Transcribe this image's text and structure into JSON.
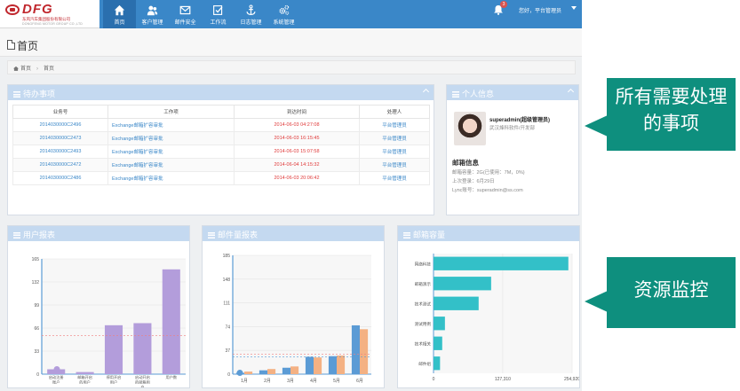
{
  "brand": {
    "logo": "DFG",
    "subtitle": "东风汽车集团股份有限公司",
    "subtitle_en": "DONGFENG MOTOR GROUP CO.,LTD"
  },
  "nav": [
    {
      "label": "首页",
      "icon": "home-icon"
    },
    {
      "label": "客户管理",
      "icon": "users-icon"
    },
    {
      "label": "邮件安全",
      "icon": "mail-icon"
    },
    {
      "label": "工作流",
      "icon": "workflow-icon"
    },
    {
      "label": "日志管理",
      "icon": "anchor-icon"
    },
    {
      "label": "系统管理",
      "icon": "gears-icon"
    }
  ],
  "header": {
    "notifications": "3",
    "user": "您好，平台管理员"
  },
  "page": {
    "title": "首页",
    "breadcrumb": [
      "首页",
      "首页"
    ]
  },
  "todo": {
    "title": "待办事项",
    "columns": [
      "业务号",
      "工作项",
      "到达时间",
      "处理人"
    ],
    "rows": [
      [
        "2014030000C2496",
        "Exchange邮箱扩容审批",
        "2014-06-03 04:27:08",
        "平台管理员"
      ],
      [
        "2014030000C2473",
        "Exchange邮箱扩容审批",
        "2014-06-03 16:15:45",
        "平台管理员"
      ],
      [
        "2014030000C2493",
        "Exchange邮箱扩容审批",
        "2014-06-03 15:07:58",
        "平台管理员"
      ],
      [
        "2014030000C2472",
        "Exchange邮箱扩容审批",
        "2014-06-04 14:15:32",
        "平台管理员"
      ],
      [
        "2014030000C2486",
        "Exchange邮箱扩容审批",
        "2014-06-03 20:06:42",
        "平台管理员"
      ]
    ]
  },
  "profile": {
    "title": "个人信息",
    "name": "superadmin(超级管理员)",
    "dept": "武汉烽科软件/开发部",
    "mail_title": "邮箱信息",
    "quota": "邮箱容量：2G(已使用：7M，0%)",
    "last_login": "上次登录：6月29日",
    "lync": "Lync账号：superadmin@ss.com"
  },
  "chart_data": [
    {
      "type": "bar",
      "title": "用户报表",
      "categories": [
        "启动注册账户",
        "邮箱开启的用户",
        "停用开启用户",
        "启动开启的邮箱用户",
        "用户数"
      ],
      "values": [
        7,
        3,
        70,
        73,
        150
      ],
      "ylim": [
        0,
        165
      ],
      "yticks": [
        0,
        33,
        66,
        99,
        132,
        165
      ],
      "colors": [
        "#b39ddb",
        "#b39ddb",
        "#b39ddb",
        "#b39ddb",
        "#b39ddb"
      ],
      "grid": true
    },
    {
      "type": "bar",
      "title": "邮件量报表",
      "categories": [
        "1月",
        "2月",
        "3月",
        "4月",
        "5月",
        "6月"
      ],
      "series": [
        {
          "values": [
            2,
            6,
            10,
            27,
            28,
            76
          ],
          "color": "#5b9bd5"
        },
        {
          "values": [
            4,
            8,
            12,
            26,
            29,
            70
          ],
          "color": "#f4b183"
        }
      ],
      "ylim": [
        0,
        185
      ],
      "yticks": [
        0,
        37,
        74,
        111,
        148,
        185
      ],
      "grid": true
    },
    {
      "type": "bar",
      "orientation": "horizontal",
      "title": "邮箱容量",
      "categories": [
        "网络科技",
        "邮箱演示",
        "技术测试",
        "测试用例",
        "技术相关",
        "邮件组"
      ],
      "values": [
        248000,
        106000,
        83000,
        21000,
        16000,
        12000
      ],
      "xlim": [
        0,
        254920
      ],
      "xticks": [
        0,
        127310,
        254920
      ],
      "xtick_labels": [
        "0",
        "127,310",
        "254,920"
      ],
      "color": "#33c0c8",
      "grid": true
    }
  ],
  "callouts": {
    "top": "所有需要处理的事项",
    "bottom": "资源监控"
  }
}
